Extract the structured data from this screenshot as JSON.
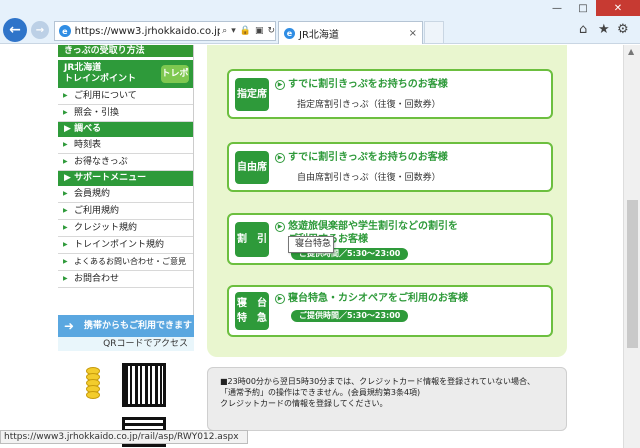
{
  "browser": {
    "url": "https://www3.jrhokkaido.co.jp/r",
    "tab_title": "JR北海道",
    "tab_close": "×",
    "window_controls": {
      "minimize": "—",
      "maximize": "□",
      "close": "✕"
    },
    "nav_back": "←",
    "nav_forward": "→",
    "status_url": "https://www3.jrhokkaido.co.jp/rail/asp/RWY012.aspx"
  },
  "sidebar": {
    "title": "きっぷの受取り方法",
    "train_point_header": "JR北海道\nトレインポイント",
    "train_point_badge": "トレポ",
    "train_point_items": [
      "ご利用について",
      "照会・引換"
    ],
    "search_header": "調べる",
    "search_items": [
      "時刻表",
      "お得なきっぷ"
    ],
    "support_header": "サポートメニュー",
    "support_items": [
      "会員規約",
      "ご利用規約",
      "クレジット規約",
      "トレインポイント規約",
      "よくあるお問い合わせ・ご意見",
      "お問合わせ"
    ],
    "mobile_banner": "携帯からもご利用できます",
    "qr_label": "QRコードでアクセス"
  },
  "cards": [
    {
      "label": "指定席",
      "title": "すでに割引きっぷをお持ちのお客様",
      "sub": "指定席割引きっぷ（往復・回数券）"
    },
    {
      "label": "自由席",
      "title": "すでに割引きっぷをお持ちのお客様",
      "sub": "自由席割引きっぷ（往復・回数券）"
    },
    {
      "label": "割　引",
      "title_line1": "悠遊旅倶楽部や学生割引などの割引を",
      "title_line2": "ご利用するお客様",
      "hours": "ご提供時間／5:30〜23:00"
    },
    {
      "label_line1": "寝　台",
      "label_line2": "特　急",
      "title": "寝台特急・カシオペアをご利用のお客様",
      "hours": "ご提供時間／5:30〜23:00"
    }
  ],
  "tooltip": "寝台特急",
  "notice": [
    "■23時00分から翌日5時30分までは、クレジットカード情報を登録されていない場合、",
    "「通常予約」の操作はできません。(会員規約第3条4項)",
    "クレジットカードの情報を登録してください。"
  ]
}
